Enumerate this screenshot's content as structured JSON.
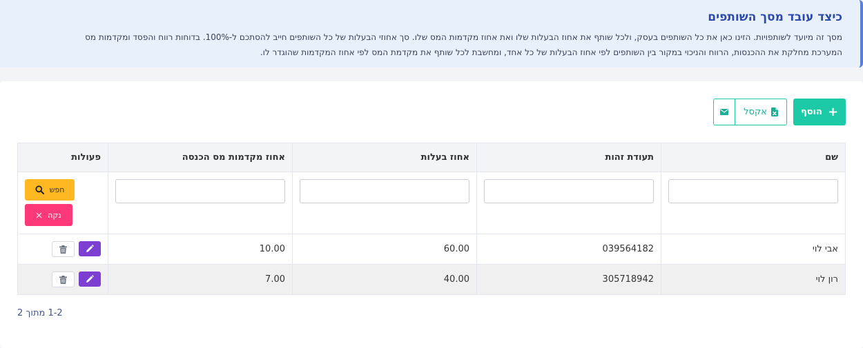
{
  "info": {
    "title": "כיצד עובד מסך השותפים",
    "line1": "מסך זה מיועד לשותפויות. הזינו כאן את כל השותפים בעסק, ולכל שותף את אחוז הבעלות שלו ואת אחוז מקדמות המס שלו. סך אחוזי הבעלות של כל השותפים חייב להסתכם ל-100%. בדוחות רווח והפסד ומקדמות מס",
    "line2": "המערכת מחלקת את ההכנסות, הרווח והניכוי במקור בין השותפים לפי אחוז הבעלות של כל אחד, ומחשבת לכל שותף את מקדמת המס לפי אחוז המקדמות שהוגדר לו."
  },
  "toolbar": {
    "add_label": "הוסף",
    "excel_label": "אקסל"
  },
  "table": {
    "headers": {
      "name": "שם",
      "id": "תעודת זהות",
      "ownership": "אחוז בעלות",
      "advance": "אחוז מקדמות מס הכנסה",
      "actions": "פעולות"
    },
    "search_label": "חפש",
    "clear_label": "נקה",
    "rows": [
      {
        "name": "אבי לוי",
        "id": "039564182",
        "ownership": "60.00",
        "advance": "10.00"
      },
      {
        "name": "רון לוי",
        "id": "305718942",
        "ownership": "40.00",
        "advance": "7.00"
      }
    ]
  },
  "pager": {
    "text": "1-2 מתוך 2"
  },
  "colors": {
    "accent": "#1ccaa8",
    "search": "#ffb822",
    "clear": "#fd397a",
    "edit": "#7c3fd1",
    "title": "#2c4aa8"
  }
}
